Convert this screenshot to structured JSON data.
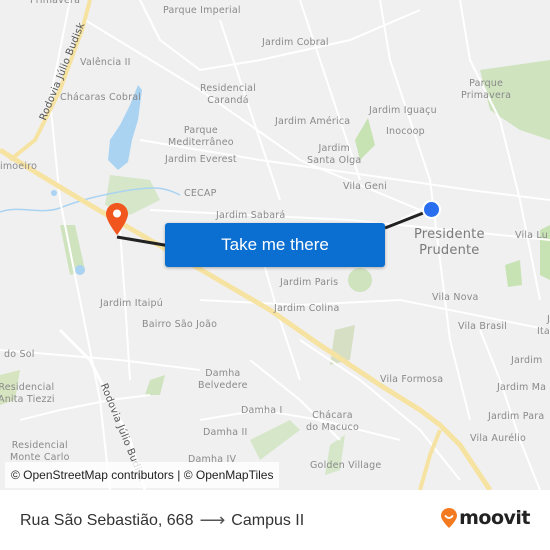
{
  "map": {
    "labels": {
      "primavera_top": "Primavera",
      "parque_imperial": "Parque Imperial",
      "jardim_cobral": "Jardim Cobral",
      "valencia_ii": "Valência II",
      "chacaras_cobral": "Chácaras Cobral",
      "residencial_caranda": "Residencial\nCarandá",
      "parque_mediterraneo": "Parque\nMediterrâneo",
      "jardim_everest": "Jardim Everest",
      "limoeiro": "imoeiro",
      "cecap": "CECAP",
      "jardim_sabara": "Jardim Sabará",
      "jardim_iguacu": "Jardim Iguaçu",
      "inocoop": "Inocoop",
      "jardim_america": "Jardim América",
      "jardim_santa_olga": "Jardim\nSanta Olga",
      "vila_geni": "Vila Geni",
      "parque_primavera": "Parque\nPrimavera",
      "presidente_prudente": "Presidente\nPrudente",
      "vila_lu": "Vila Lu",
      "jardim_paris": "Jardim Paris",
      "jardim_colina": "Jardim Colina",
      "vila_nova": "Vila Nova",
      "vila_brasil": "Vila Brasil",
      "ita": "J\nIta",
      "jardim_itaipu": "Jardim Itaipú",
      "bairro_sao_joao": "Bairro São João",
      "do_sol": "do Sol",
      "residencial_anita_tiezzi": "Residencial\nAnita Tiezzi",
      "residencial_monte_carlo": "Residencial\nMonte Carlo",
      "damha_belvedere": "Damha\nBelvedere",
      "damha_i": "Damha I",
      "damha_ii": "Damha II",
      "damha_iv": "Damha IV",
      "chacara_do_macuco": "Chácara\ndo Macuco",
      "golden_village": "Golden Village",
      "vila_formosa": "Vila Formosa",
      "jardim_right": "Jardim",
      "jardim_ma": "Jardim Ma",
      "jardim_para": "Jardim Para",
      "vila_aurelio": "Vila Aurélio",
      "rodovia_top": "Rodovia Júlio Budisk",
      "rodovia_bottom": "Rodovia Júlio Budisk"
    },
    "origin_marker_icon": "map-pin-icon",
    "destination_marker_icon": "location-dot-icon",
    "cta_label": "Take me there",
    "attribution": "© OpenStreetMap contributors | © OpenMapTiles",
    "colors": {
      "cta": "#0a6fd1",
      "origin_pin": "#f0561d",
      "destination_dot": "#2a6ef0",
      "route_line": "#222222",
      "highway": "#f7e3a1",
      "water": "#aad3f2",
      "park": "#cfe3bf"
    }
  },
  "footer": {
    "origin": "Rua São Sebastião, 668",
    "arrow_icon": "arrow-right-icon",
    "destination": "Campus II",
    "brand": "moovit",
    "brand_color": "#f47a20"
  }
}
